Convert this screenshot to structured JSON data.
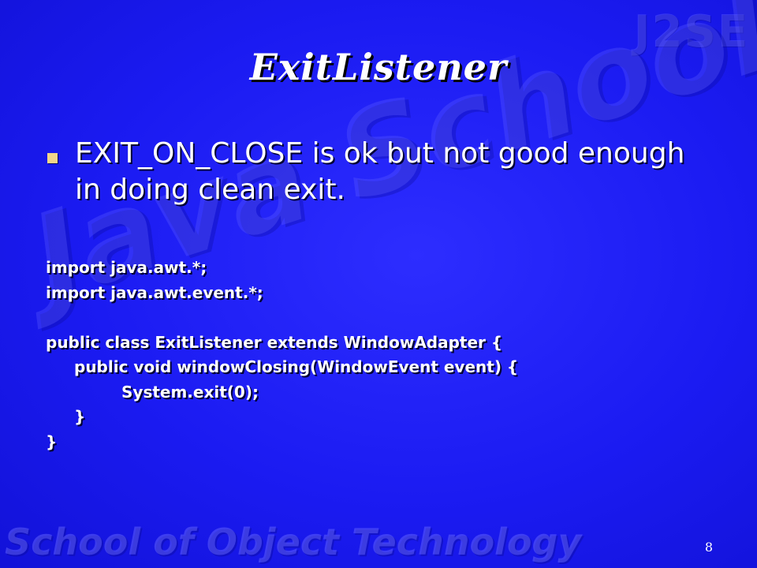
{
  "slide": {
    "watermark_corner": "J2SE",
    "watermark_center": "Java School",
    "watermark_footer": "School of Object Technology",
    "title": "ExitListener",
    "bullet_text": "EXIT_ON_CLOSE is ok but not good enough in doing clean exit.",
    "code_lines": [
      "import java.awt.*;",
      "import java.awt.event.*;",
      "",
      "public class ExitListener extends WindowAdapter {",
      "public void windowClosing(WindowEvent event) {",
      "System.exit(0);",
      "}",
      "}"
    ],
    "page_number": "8",
    "colors": {
      "background": "#1a1aff",
      "bullet_marker": "#f2d58a",
      "text": "#ffffff"
    }
  }
}
